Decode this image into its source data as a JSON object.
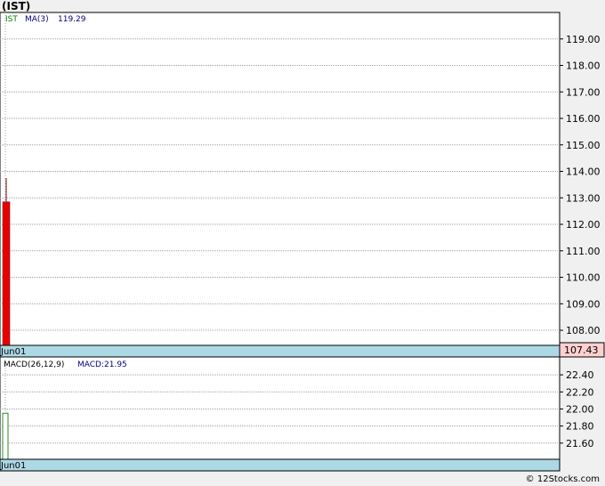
{
  "title": "(IST)",
  "credit": "© 12Stocks.com",
  "colors": {
    "down_candle": "#e60000",
    "macd_bar": "#2e8b2e",
    "ma_label": "#000080",
    "date_strip": "#add8e6",
    "last_price_bg": "#ffd0d0",
    "grid": "#a0a0a0"
  },
  "chart_data": [
    {
      "type": "candlestick",
      "legend": {
        "symbol": "IST",
        "ma_label": "MA(3)",
        "ma_value": "119.29"
      },
      "ylim": [
        107.43,
        120.0
      ],
      "y_ticks": [
        {
          "value": 108.0,
          "label": "108.00"
        },
        {
          "value": 109.0,
          "label": "109.00"
        },
        {
          "value": 110.0,
          "label": "110.00"
        },
        {
          "value": 111.0,
          "label": "111.00"
        },
        {
          "value": 112.0,
          "label": "112.00"
        },
        {
          "value": 113.0,
          "label": "113.00"
        },
        {
          "value": 114.0,
          "label": "114.00"
        },
        {
          "value": 115.0,
          "label": "115.00"
        },
        {
          "value": 116.0,
          "label": "116.00"
        },
        {
          "value": 117.0,
          "label": "117.00"
        },
        {
          "value": 118.0,
          "label": "118.00"
        },
        {
          "value": 119.0,
          "label": "119.00"
        }
      ],
      "candles": [
        {
          "date": "Jun01",
          "open": 112.85,
          "high": 113.75,
          "low": 107.43,
          "close": 107.43
        }
      ],
      "x_label": "Jun01",
      "last_price": "107.43"
    },
    {
      "type": "bar",
      "legend": {
        "label": "MACD(26,12,9)",
        "value_label": "MACD:21.95"
      },
      "ylim": [
        21.41,
        22.61
      ],
      "y_ticks": [
        {
          "value": 21.6,
          "label": "21.60"
        },
        {
          "value": 21.8,
          "label": "21.80"
        },
        {
          "value": 22.0,
          "label": "22.00"
        },
        {
          "value": 22.2,
          "label": "22.20"
        },
        {
          "value": 22.4,
          "label": "22.40"
        }
      ],
      "bars": [
        {
          "date": "Jun01",
          "value": 21.95
        }
      ],
      "x_label": "Jun01"
    }
  ]
}
